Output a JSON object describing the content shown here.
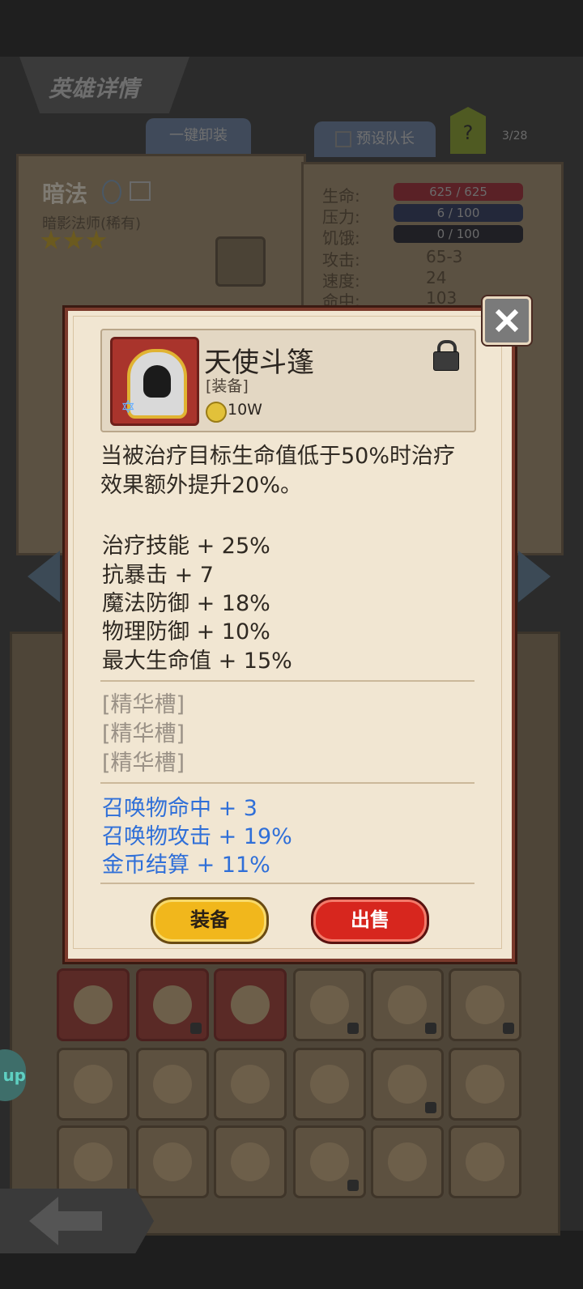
{
  "background": {
    "hero_title": "英雄详情",
    "unequip_all": "一键卸装",
    "preset_leader": "预设队长",
    "help": "?",
    "page_count": "3/28",
    "hero_name": "暗法",
    "hero_class": "暗影法师(稀有)",
    "stars": 3,
    "stats": [
      {
        "label": "生命:",
        "value": "625 / 625",
        "bar": "red"
      },
      {
        "label": "压力:",
        "value": "6 / 100",
        "bar": "blue"
      },
      {
        "label": "饥饿:",
        "value": "0 / 100",
        "bar": "dark"
      },
      {
        "label": "攻击:",
        "value": "65-3"
      },
      {
        "label": "速度:",
        "value": "24"
      },
      {
        "label": "命中:",
        "value": "103"
      }
    ],
    "side_tab": "up"
  },
  "popup": {
    "item_name": "天使斗篷",
    "item_type": "[装备]",
    "price": "10W",
    "description": "当被治疗目标生命值低于50%时治疗效果额外提升20%。",
    "stats": [
      "治疗技能 + 25%",
      "抗暴击 + 7",
      "魔法防御 + 18%",
      "物理防御 + 10%",
      "最大生命值 + 15%"
    ],
    "essence_slots": [
      "[精华槽]",
      "[精华槽]",
      "[精华槽]"
    ],
    "bonus_stats": [
      "召唤物命中 + 3",
      "召唤物攻击 + 19%",
      "金币结算 + 11%"
    ],
    "equip_button": "装备",
    "sell_button": "出售"
  },
  "colors": {
    "popup_bg": "#f1e6d2",
    "bonus_text": "#2f6fd8",
    "equip": "#f1b71c",
    "sell": "#d7261e"
  }
}
